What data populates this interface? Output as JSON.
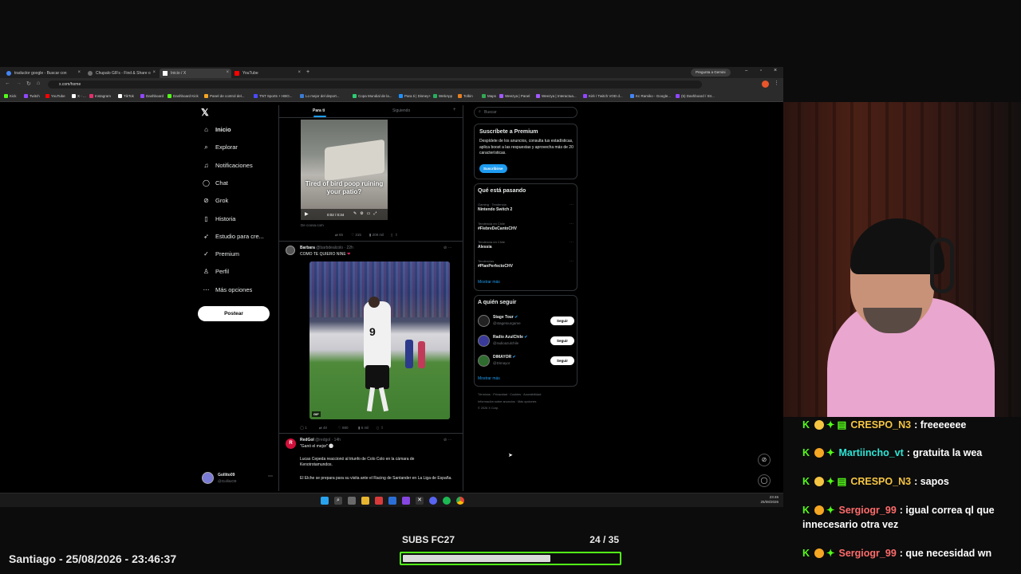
{
  "browser": {
    "tabs": [
      {
        "label": "traductor google - Buscar con",
        "color": "#4285f4"
      },
      {
        "label": "Chupalo GIFs - Find & Share o",
        "color": "#6e6e6e"
      },
      {
        "label": "Inicio / X",
        "color": "#ffffff"
      },
      {
        "label": "YouTube",
        "color": "#ff0000"
      }
    ],
    "gemini_label": "Pregunta a Gemini",
    "url": "x.com/home",
    "bookmarks": [
      "Kick",
      "Twitch",
      "YouTube",
      "X - ...",
      "Instagram",
      "TikTok",
      "Dashboard",
      "Dashboard Kick",
      "Panel de control del...",
      "TNT Sports + HBO...",
      "Lo mejor del deport...",
      "Copa Mundial de la...",
      "Para ti | Disney+",
      "WebApp",
      "Tolbin",
      "Maps",
      "Weezya | Panel",
      "Weezya | Interactua...",
      "Kirk / Twitch VOD d...",
      "Kc Ramiko - Google...",
      "(5) Dashboard / Str..."
    ]
  },
  "sidebar": {
    "items": [
      {
        "label": "Inicio",
        "icon": "home-icon",
        "glyph": "⌂"
      },
      {
        "label": "Explorar",
        "icon": "search-icon",
        "glyph": "⌕"
      },
      {
        "label": "Notificaciones",
        "icon": "bell-icon",
        "glyph": "♫"
      },
      {
        "label": "Chat",
        "icon": "chat-icon",
        "glyph": "◯"
      },
      {
        "label": "Grok",
        "icon": "grok-icon",
        "glyph": "⊘"
      },
      {
        "label": "Historia",
        "icon": "bookmark-icon",
        "glyph": "▯"
      },
      {
        "label": "Estudio para cre...",
        "icon": "rocket-icon",
        "glyph": "➶"
      },
      {
        "label": "Premium",
        "icon": "premium-icon",
        "glyph": "✓"
      },
      {
        "label": "Perfil",
        "icon": "person-icon",
        "glyph": "♙"
      },
      {
        "label": "Más opciones",
        "icon": "more-icon",
        "glyph": "⋯"
      }
    ],
    "post_label": "Postear",
    "account_name": "Gollito09",
    "account_handle": "@GollitoO9"
  },
  "feed": {
    "tabs": [
      "Para ti",
      "Siguiendo"
    ],
    "video_caption": "Tired of bird poop ruining your patio?",
    "video_time": "0:02 / 0:34",
    "ad_source": "De coosa.com",
    "ad_stats": [
      "65",
      "315",
      "209 mil"
    ],
    "tweet1": {
      "name": "Barbara",
      "handle": "@barbdealcolo · 22h",
      "text": "COMO TE QUIERO NINE",
      "stats": [
        "1",
        "48",
        "880",
        "6 mil"
      ],
      "gif_label": "GIF"
    },
    "tweet2": {
      "name": "RedGol",
      "handle": "@redgol · 14h",
      "line1": "\"Ganó el mejor\"",
      "line2": "Lucas Cepeda reaccionó al triunfo de Colo Colo en la cámara de Kenotrotamundos.",
      "line3": "El Elche se prepara para su visita ante el Racing de Santander en La Liga de España."
    }
  },
  "right": {
    "search_placeholder": "Buscar",
    "premium_title": "Suscríbete a Premium",
    "premium_text": "Despídete de los anuncios, consulta tus estadísticas, aplica boost a las respuestas y aprovecha más de 20 características.",
    "premium_button": "Suscribirse",
    "trends_title": "Qué está pasando",
    "trends": [
      {
        "context": "Gaming · Tendencia",
        "title": "Nintendo Switch 2"
      },
      {
        "context": "Tendencia en Chile",
        "title": "#FiebreDeCantoCHV"
      },
      {
        "context": "Tendencia en Chile",
        "title": "Alessia"
      },
      {
        "context": "Tendencias",
        "title": "#PlanPerfectoCHV"
      }
    ],
    "show_more": "Mostrar más",
    "follow_title": "A quién seguir",
    "follow": [
      {
        "name": "Stage Tour",
        "handle": "@stagetourgame"
      },
      {
        "name": "Radio AzulChile",
        "handle": "@radioazulchile"
      },
      {
        "name": "DIMAYOR",
        "handle": "@Dimayor"
      }
    ],
    "follow_button": "Seguir",
    "footer1": "Términos · Privacidad · Cookies · Accesibilidad",
    "footer2": "Información sobre anuncios · Más opciones",
    "footer3": "© 2026 X Corp."
  },
  "taskbar": {
    "time": "23:46",
    "date": "25/08/2026"
  },
  "chat": [
    {
      "user": "CRESPO_N3",
      "color": "#f5c542",
      "message": ": freeeeeee"
    },
    {
      "user": "Martiincho_vt",
      "color": "#2ee6d6",
      "message": ": gratuita la wea"
    },
    {
      "user": "CRESPO_N3",
      "color": "#f5c542",
      "message": ": sapos"
    },
    {
      "user": "Sergiogr_99",
      "color": "#ff6b6b",
      "message": ": igual correa ql que"
    },
    {
      "user": "",
      "color": "#ffffff",
      "message": "innecesario otra vez"
    },
    {
      "user": "Sergiogr_99",
      "color": "#ff6b6b",
      "message": ": que necesidad wn"
    }
  ],
  "overlay": {
    "location_time": "Santiago - 25/08/2026 - 23:46:37",
    "subs_label": "SUBS FC27",
    "subs_count": "24 / 35",
    "progress": 0.6857
  }
}
